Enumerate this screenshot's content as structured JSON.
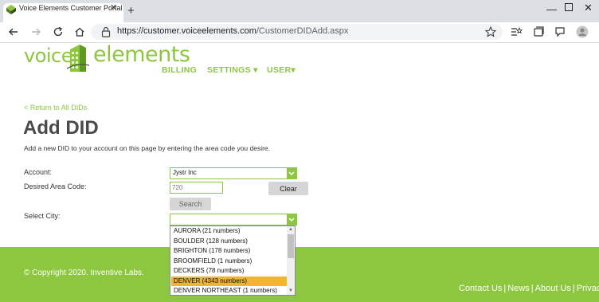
{
  "browser": {
    "tab_title": "Voice Elements Customer Portal",
    "url_host": "https://customer.voiceelements.com",
    "url_path": "/CustomerDIDAdd.aspx",
    "tab_close": "✕",
    "new_tab": "+",
    "window_min": "—",
    "window_close": "✕"
  },
  "logo": {
    "left_text": "voice",
    "right_text": "elements"
  },
  "nav": {
    "billing": "BILLING",
    "settings": "SETTINGS ▾",
    "user": "USER▾"
  },
  "page": {
    "return_link": "< Return to All DIDs",
    "title": "Add DID",
    "description": "Add a new DID to your account on this page by entering the area code you desire."
  },
  "form": {
    "account_label": "Account:",
    "account_value": "Jystr Inc",
    "area_code_label": "Desired Area Code:",
    "area_code_placeholder": "720",
    "clear_label": "Clear",
    "search_label": "Search",
    "city_label": "Select City:",
    "city_value": ""
  },
  "city_options": [
    {
      "label": "AURORA (21 numbers)"
    },
    {
      "label": "BOULDER (128 numbers)"
    },
    {
      "label": "BRIGHTON (178 numbers)"
    },
    {
      "label": "BROOMFIELD (1 numbers)"
    },
    {
      "label": "DECKERS (78 numbers)"
    },
    {
      "label": "DENVER (4343 numbers)",
      "selected": true
    },
    {
      "label": "DENVER NORTHEAST (1 numbers)"
    }
  ],
  "footer": {
    "copyright": "© Copyright 2020. Inventive Labs.",
    "contact": "Contact Us",
    "news": "News",
    "about": "About Us",
    "privacy": "Privacy",
    "separator": "|"
  },
  "colors": {
    "brand_green": "#8dc63f",
    "selected_option": "#f0b52a",
    "title_gray": "#4a4a4a"
  }
}
